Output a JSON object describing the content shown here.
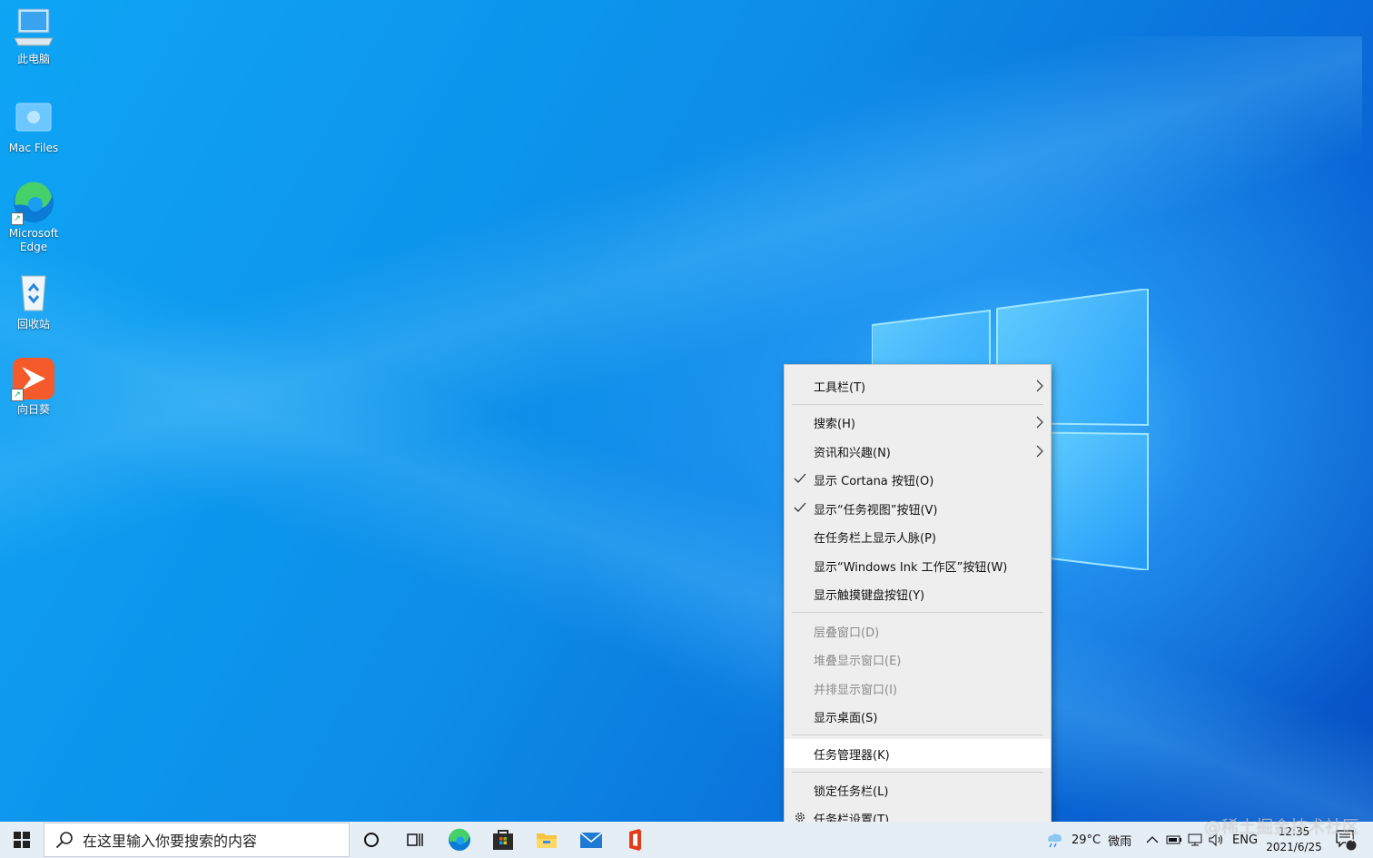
{
  "desktop": {
    "icons": [
      {
        "label": "此电脑"
      },
      {
        "label": "Mac Files"
      },
      {
        "label": "Microsoft Edge"
      },
      {
        "label": "回收站"
      },
      {
        "label": "向日葵"
      }
    ]
  },
  "context_menu": {
    "items": [
      {
        "label": "工具栏(T)",
        "submenu": true
      },
      {
        "label": "搜索(H)",
        "submenu": true
      },
      {
        "label": "资讯和兴趣(N)",
        "submenu": true
      },
      {
        "label": "显示 Cortana 按钮(O)",
        "checked": true
      },
      {
        "label": "显示“任务视图”按钮(V)",
        "checked": true
      },
      {
        "label": "在任务栏上显示人脉(P)"
      },
      {
        "label": "显示“Windows Ink 工作区”按钮(W)"
      },
      {
        "label": "显示触摸键盘按钮(Y)"
      },
      {
        "label": "层叠窗口(D)",
        "disabled": true
      },
      {
        "label": "堆叠显示窗口(E)",
        "disabled": true
      },
      {
        "label": "并排显示窗口(I)",
        "disabled": true
      },
      {
        "label": "显示桌面(S)"
      },
      {
        "label": "任务管理器(K)",
        "highlighted": true
      },
      {
        "label": "锁定任务栏(L)"
      },
      {
        "label": "任务栏设置(T)",
        "icon": "gear-icon"
      }
    ]
  },
  "taskbar": {
    "search_placeholder": "在这里输入你要搜索的内容",
    "pinned_apps": [
      "cortana-circle-icon",
      "task-view-icon",
      "edge-icon",
      "store-icon",
      "file-explorer-icon",
      "mail-icon",
      "office-icon"
    ],
    "weather": {
      "temp": "29°C",
      "condition": "微雨"
    },
    "language": "ENG",
    "time": "12:35",
    "date": "2021/6/25",
    "notification_count": "4"
  },
  "watermark": "@稀土掘金技术社区",
  "colors": {
    "accent": "#0078d7",
    "menu_bg": "#eeeeee",
    "taskbar_bg": "#e6eef5"
  }
}
